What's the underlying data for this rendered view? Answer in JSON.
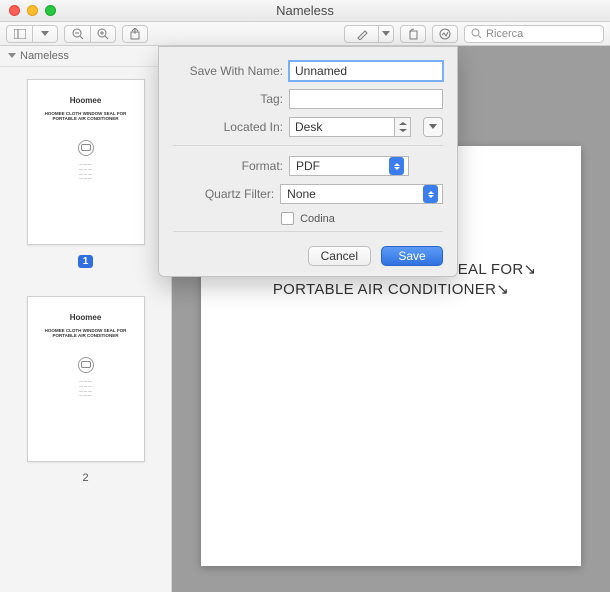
{
  "window": {
    "title": "Nameless"
  },
  "toolbar": {
    "search_placeholder": "Ricerca"
  },
  "sidebar": {
    "header": "Nameless",
    "pages": [
      {
        "num_badge": "1",
        "badge": true
      },
      {
        "num": "2",
        "badge": false
      }
    ]
  },
  "thumb_content": {
    "brand": "Hoomee",
    "subtitle": "HOOMEE CLOTH WINDOW SEAL FOR PORTABLE AIR CONDITIONER",
    "lines": "———\n———\n———\n———"
  },
  "document": {
    "heading": "Hoomee",
    "subtitle_l1": "HOOMEE CLOTH WINDOW SEAL FOR",
    "subtitle_l2": "PORTABLE AIR CONDITIONER"
  },
  "dialog": {
    "labels": {
      "save_with_name": "Save With Name:",
      "tag": "Tag:",
      "located_in": "Located In:",
      "format": "Format:",
      "quartz_filter": "Quartz Filter:",
      "encrypt": "Codina"
    },
    "values": {
      "name": "Unnamed",
      "tag": "",
      "location": "Desk",
      "format": "PDF",
      "filter": "None",
      "encrypt_checked": false
    },
    "buttons": {
      "cancel": "Cancel",
      "save": "Save"
    }
  }
}
